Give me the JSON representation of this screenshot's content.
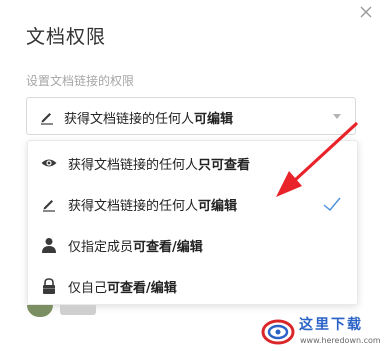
{
  "dialog": {
    "title": "文档权限",
    "subtitle": "设置文档链接的权限",
    "close_icon": "close-icon"
  },
  "select": {
    "selected_prefix": "获得文档链接的任何人",
    "selected_strong": "可编辑",
    "icon": "pencil-icon"
  },
  "options": [
    {
      "prefix": "获得文档链接的任何人",
      "strong": "只可查看",
      "icon": "eye-icon",
      "selected": false
    },
    {
      "prefix": "获得文档链接的任何人",
      "strong": "可编辑",
      "icon": "pencil-icon",
      "selected": true
    },
    {
      "prefix": "仅指定成员",
      "strong": "可查看/编辑",
      "icon": "person-icon",
      "selected": false
    },
    {
      "prefix": "仅自己",
      "strong": "可查看/编辑",
      "icon": "lock-icon",
      "selected": false
    }
  ],
  "colors": {
    "accent": "#4a90e2",
    "annotation_arrow": "#e8232a",
    "text": "#222222",
    "muted": "#a6a6a6"
  },
  "watermark": {
    "text": "这里下载",
    "url": "www.heredown.com"
  }
}
